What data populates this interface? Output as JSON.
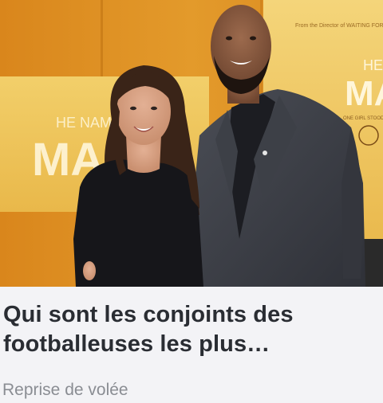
{
  "article": {
    "image_alt": "Hope Solo et son conjoint lors d'une avant-première",
    "poster_left_text": "HE NAM\nMAI",
    "poster_right_text": "HE NA\nMA",
    "title": "Qui sont les conjoints des footballeuses les plus…",
    "source": "Reprise de volée"
  }
}
